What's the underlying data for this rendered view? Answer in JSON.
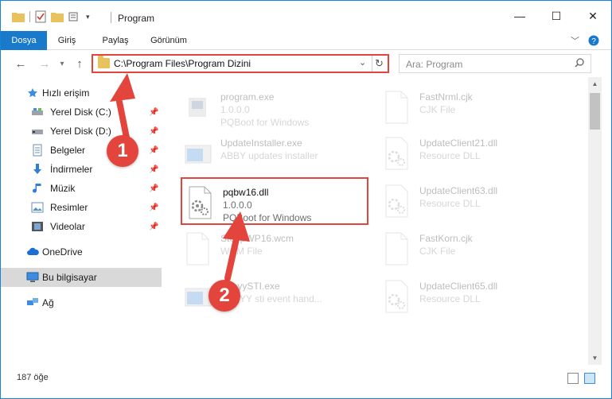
{
  "window": {
    "title": "Program",
    "controls": {
      "minimize": "—",
      "maximize": "☐",
      "close": "✕"
    }
  },
  "ribbon": {
    "tabs": [
      {
        "label": "Dosya"
      },
      {
        "label": "Giriş"
      },
      {
        "label": "Paylaş"
      },
      {
        "label": "Görünüm"
      }
    ]
  },
  "nav": {
    "address": "C:\\Program Files\\Program Dizini",
    "search_placeholder": "Ara: Program"
  },
  "sidebar": {
    "quick_access_label": "Hızlı erişim",
    "items": [
      {
        "label": "Yerel Disk (C:)",
        "icon": "drive-icon"
      },
      {
        "label": "Yerel Disk (D:)",
        "icon": "drive-icon"
      },
      {
        "label": "Belgeler",
        "icon": "documents-icon"
      },
      {
        "label": "İndirmeler",
        "icon": "downloads-icon"
      },
      {
        "label": "Müzik",
        "icon": "music-icon"
      },
      {
        "label": "Resimler",
        "icon": "pictures-icon"
      },
      {
        "label": "Videolar",
        "icon": "videos-icon"
      }
    ],
    "onedrive_label": "OneDrive",
    "this_pc_label": "Bu bilgisayar",
    "network_label": "Ağ"
  },
  "files": {
    "left": [
      {
        "name": "program.exe",
        "line2": "1.0.0.0",
        "line3": "PQBoot for Windows",
        "icon": "exe-icon"
      },
      {
        "name": "UpdateInstaller.exe",
        "line2": "ABBY updates installer",
        "line3": "",
        "icon": "app-icon"
      },
      {
        "name": "pqbw16.dll",
        "line2": "1.0.0.0",
        "line3": "PQBoot for Windows",
        "icon": "dll-icon"
      },
      {
        "name": "StoppWP16.wcm",
        "line2": "WCM File",
        "line3": "",
        "icon": "file-icon"
      },
      {
        "name": "AbbyySTI.exe",
        "line2": "ABBYY sti event hand...",
        "line3": "",
        "icon": "app-icon"
      }
    ],
    "right": [
      {
        "name": "FastNrml.cjk",
        "line2": "CJK File",
        "icon": "file-icon"
      },
      {
        "name": "UpdateClient21.dll",
        "line2": "Resource DLL",
        "icon": "dll-icon"
      },
      {
        "name": "UpdateClient63.dll",
        "line2": "Resource DLL",
        "icon": "dll-icon"
      },
      {
        "name": "FastKorn.cjk",
        "line2": "CJK File",
        "icon": "file-icon"
      },
      {
        "name": "UpdateClient65.dll",
        "line2": "Resource DLL",
        "icon": "dll-icon"
      }
    ]
  },
  "status": {
    "item_count": "187 öğe"
  },
  "callouts": {
    "one": "1",
    "two": "2"
  },
  "colors": {
    "accent": "#1979ca",
    "highlight": "#e3453d",
    "selected": "#d9d9d9"
  }
}
